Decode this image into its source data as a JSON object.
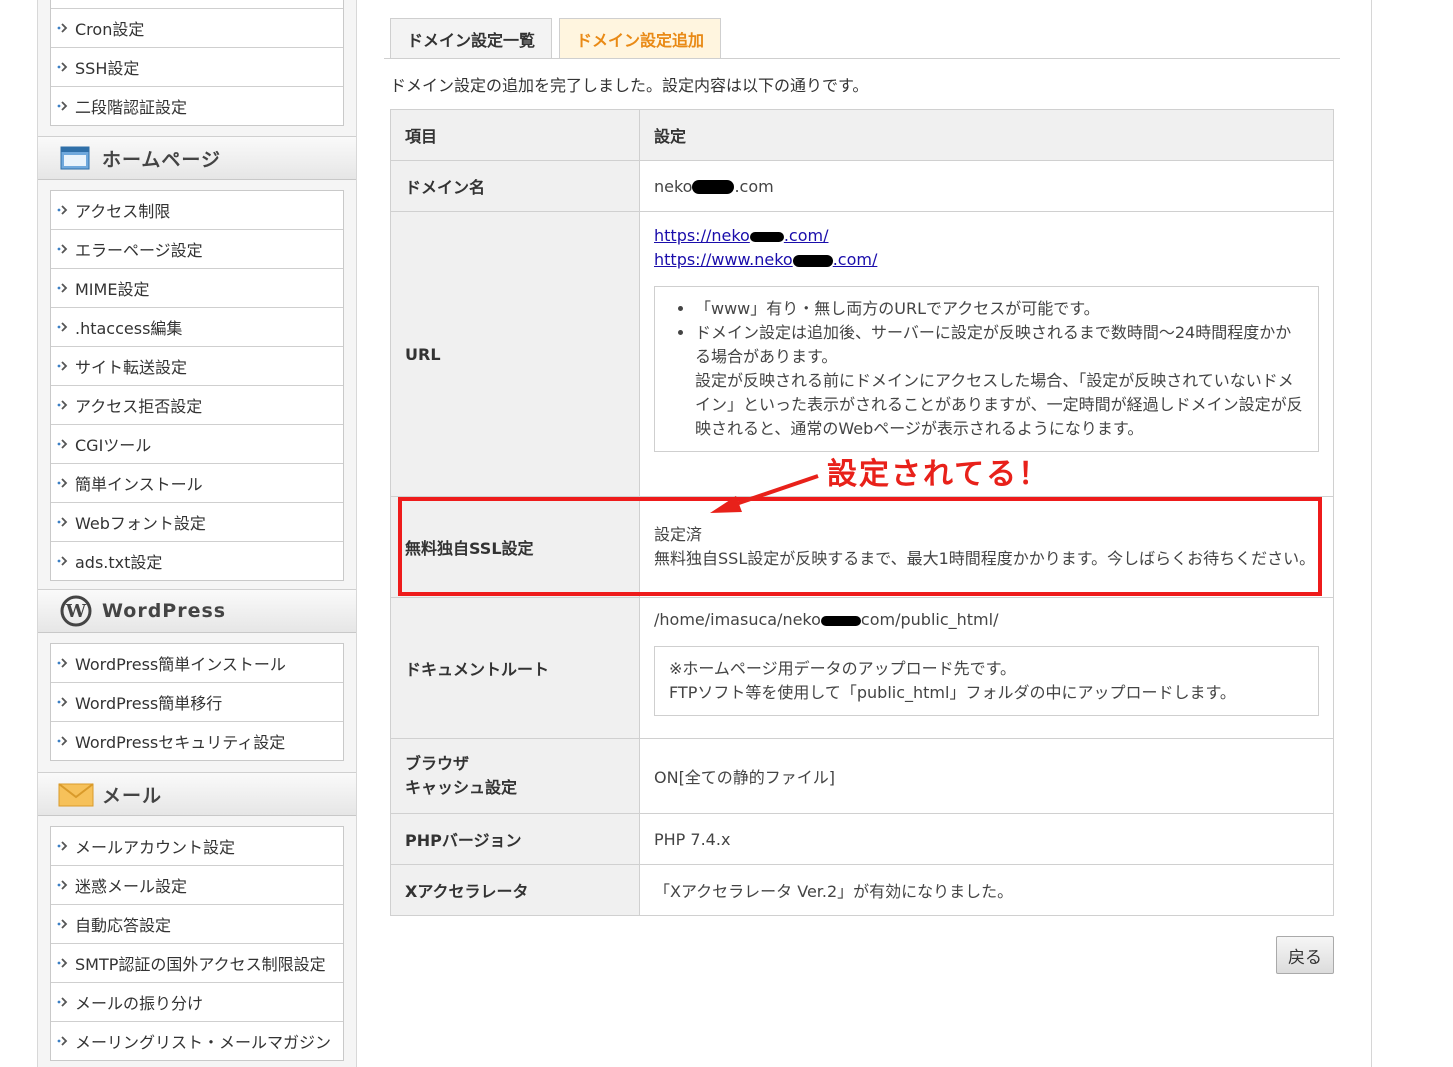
{
  "sidebar": {
    "server_group": [
      "Cron設定",
      "SSH設定",
      "二段階認証設定"
    ],
    "homepage_header": "ホームページ",
    "homepage_group": [
      "アクセス制限",
      "エラーページ設定",
      "MIME設定",
      ".htaccess編集",
      "サイト転送設定",
      "アクセス拒否設定",
      "CGIツール",
      "簡単インストール",
      "Webフォント設定",
      "ads.txt設定"
    ],
    "wordpress_header": "WordPress",
    "wordpress_group": [
      "WordPress簡単インストール",
      "WordPress簡単移行",
      "WordPressセキュリティ設定"
    ],
    "mail_header": "メール",
    "mail_group": [
      "メールアカウント設定",
      "迷惑メール設定",
      "自動応答設定",
      "SMTP認証の国外アクセス制限設定",
      "メールの振り分け",
      "メーリングリスト・メールマガジン"
    ]
  },
  "tabs": {
    "list": "ドメイン設定一覧",
    "add": "ドメイン設定追加"
  },
  "message": "ドメイン設定の追加を完了しました。設定内容は以下の通りです。",
  "table": {
    "header_item": "項目",
    "header_setting": "設定",
    "domain_label": "ドメイン名",
    "domain_prefix": "neko",
    "domain_suffix": ".com",
    "url_label": "URL",
    "url_https_prefix": "https://neko",
    "url_https_suffix": ".com/",
    "url_www_prefix": "https://www.neko",
    "url_www_suffix": ".com/",
    "url_note_1": "「www」有り・無し両方のURLでアクセスが可能です。",
    "url_note_2a": "ドメイン設定は追加後、サーバーに設定が反映されるまで数時間〜24時間程度かかる場合があります。",
    "url_note_2b": "設定が反映される前にドメインにアクセスした場合、「設定が反映されていないドメイン」といった表示がされることがありますが、一定時間が経過しドメイン設定が反映されると、通常のWebページが表示されるようになります。",
    "ssl_label": "無料独自SSL設定",
    "ssl_status": "設定済",
    "ssl_note": "無料独自SSL設定が反映するまで、最大1時間程度かかります。今しばらくお待ちください。",
    "docroot_label": "ドキュメントルート",
    "docroot_prefix": "/home/imasuca/neko",
    "docroot_suffix": "com/public_html/",
    "docroot_note_1": "※ホームページ用データのアップロード先です。",
    "docroot_note_2": "FTPソフト等を使用して「public_html」フォルダの中にアップロードします。",
    "cache_label_1": "ブラウザ",
    "cache_label_2": "キャッシュ設定",
    "cache_value": "ON[全ての静的ファイル]",
    "php_label": "PHPバージョン",
    "php_value": "PHP 7.4.x",
    "xacc_label": "Xアクセラレータ",
    "xacc_value": "「Xアクセラレータ Ver.2」が有効になりました。"
  },
  "annotation": "設定されてる！",
  "back_button": "戻る",
  "colors": {
    "active_tab_text": "#e98a16",
    "annotation_red": "#e8211a",
    "link": "#1a0dab"
  }
}
